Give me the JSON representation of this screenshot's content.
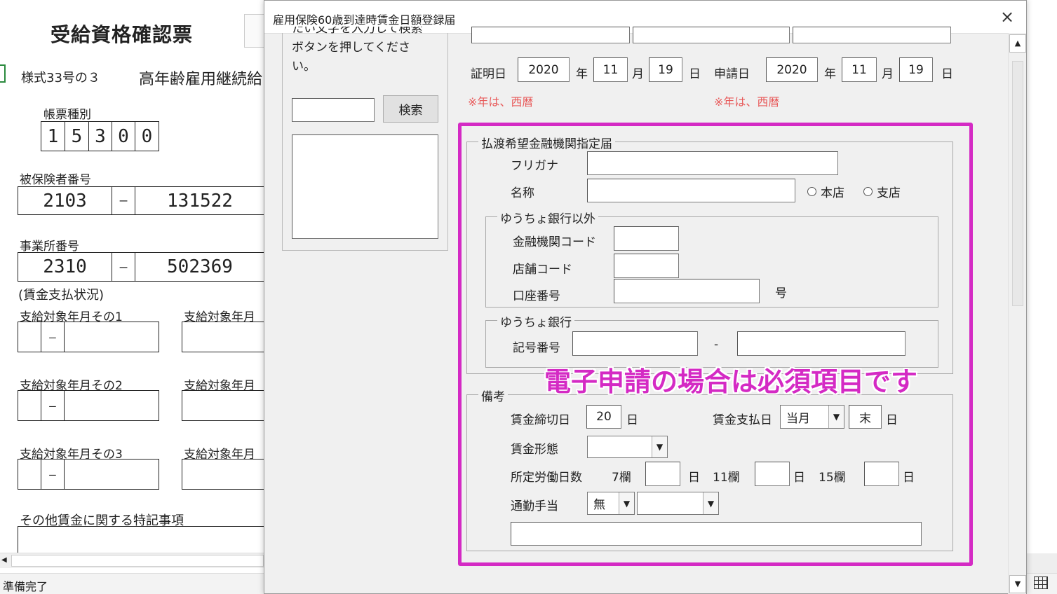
{
  "sheet": {
    "title": "受給資格確認票",
    "form_no": "様式33号の３",
    "form_name": "高年齢雇用継続給",
    "form_type_label": "帳票種別",
    "form_type_digits": [
      "1",
      "5",
      "3",
      "0",
      "0"
    ],
    "insured_label": "被保険者番号",
    "insured_part1": "2103",
    "insured_dash": "―",
    "insured_part2": "131522",
    "office_label": "事業所番号",
    "office_part1": "2310",
    "office_dash": "―",
    "office_part2": "502369",
    "wage_status": "(賃金支払状況)",
    "pay_month_1": "支給対象年月その1",
    "pay_month_2": "支給対象年月その2",
    "pay_month_3": "支給対象年月その3",
    "pay_month_right": "支給対象年月",
    "cell_dash": "―",
    "special_notes": "その他賃金に関する特記事項",
    "status": "準備完了"
  },
  "dialog": {
    "title": "雇用保険60歳到達時賃金日額登録届",
    "close": "×",
    "search_hint": "たい文字を入力して検索ボタンを押してください。",
    "search_input": "",
    "search_button": "検索",
    "cert_date_label": "証明日",
    "cert_year": "2020",
    "cert_month": "11",
    "cert_day": "19",
    "apply_date_label": "申請日",
    "apply_year": "2020",
    "apply_month": "11",
    "apply_day": "19",
    "year_unit": "年",
    "month_unit": "月",
    "day_unit": "日",
    "year_note": "※年は、西暦",
    "bank_group": "払渡希望金融機関指定届",
    "furigana_label": "フリガナ",
    "name_label": "名称",
    "radio_head": "本店",
    "radio_branch": "支店",
    "non_post_group": "ゆうちょ銀行以外",
    "bank_code_label": "金融機関コード",
    "branch_code_label": "店舗コード",
    "account_no_label": "口座番号",
    "account_no_unit": "号",
    "post_group": "ゆうちょ銀行",
    "symbol_no_label": "記号番号",
    "symbol_dash": "-",
    "notes_group": "備考",
    "closing_day_label": "賃金締切日",
    "closing_day_value": "20",
    "pay_day_label": "賃金支払日",
    "pay_day_month": "当月",
    "pay_day_value": "末",
    "wage_form_label": "賃金形態",
    "wage_form_value": "",
    "work_days_label": "所定労働日数",
    "col7": "7欄",
    "col11": "11欄",
    "col15": "15欄",
    "commute_label": "通勤手当",
    "commute_value": "無",
    "commute_type": "",
    "callout": "電子申請の場合は必須項目です"
  },
  "colors": {
    "highlight": "#d42ac4",
    "note_red": "#e85a5a"
  }
}
